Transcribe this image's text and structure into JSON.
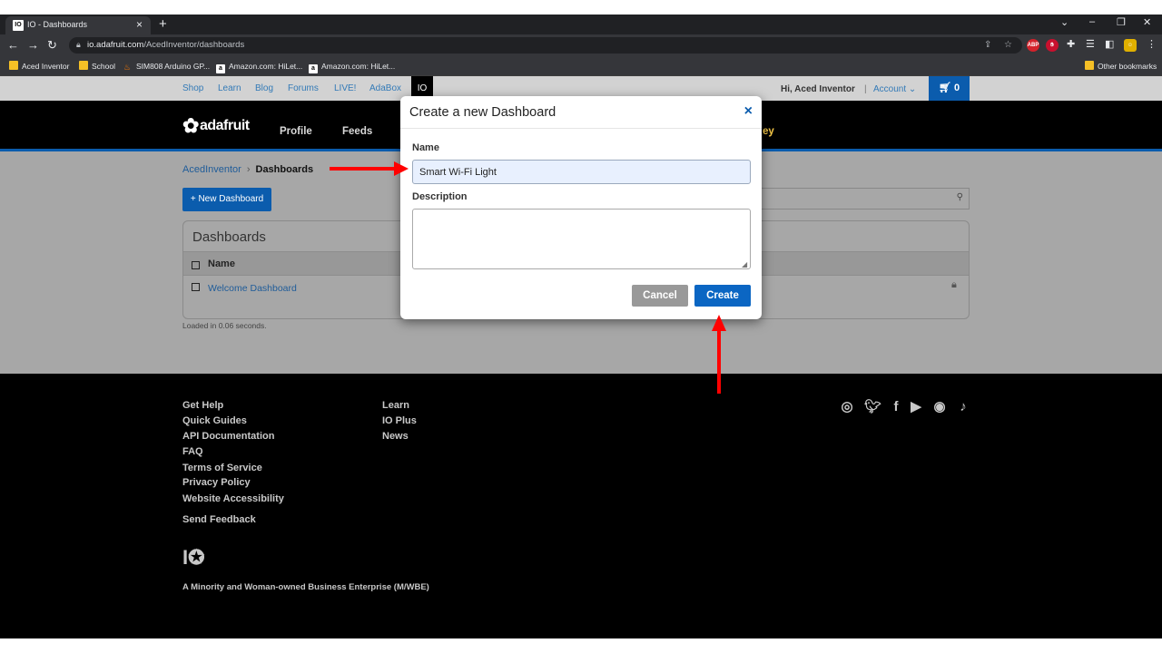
{
  "browser": {
    "tab_title": "IO - Dashboards",
    "tab_favicon": "IO",
    "tab_close_icon": "×",
    "new_tab_icon": "+",
    "url_host": "io.adafruit.com",
    "url_path": "/AcedInventor/dashboards",
    "extension_abp": "ABP",
    "bookmarks": [
      {
        "label": "Aced Inventor",
        "icon": "folder-icon"
      },
      {
        "label": "School",
        "icon": "folder-icon"
      },
      {
        "label": "SIM808 Arduino GP...",
        "icon": "sim-icon"
      },
      {
        "label": "Amazon.com: HiLet...",
        "icon": "amazon-icon"
      },
      {
        "label": "Amazon.com: HiLet...",
        "icon": "amazon-icon"
      }
    ],
    "other_bookmarks": "Other bookmarks"
  },
  "site": {
    "top_links": [
      "Shop",
      "Learn",
      "Blog",
      "Forums",
      "LIVE!",
      "AdaBox"
    ],
    "io_tab": "IO",
    "greeting": "Hi, Aced Inventor",
    "separator": "|",
    "account": "Account",
    "cart_count": "0",
    "logo_text": "adafruit",
    "nav": [
      "Profile",
      "Feeds"
    ],
    "nav_partial": "ey"
  },
  "content": {
    "breadcrumb_user": "AcedInventor",
    "breadcrumb_current": "Dashboards",
    "new_dashboard": "+ New Dashboard",
    "panel_title": "Dashboards",
    "column_name": "Name",
    "rows": [
      {
        "name": "Welcome Dashboard"
      }
    ],
    "loaded": "Loaded in 0.06 seconds."
  },
  "footer": {
    "col1": [
      "Get Help",
      "Quick Guides",
      "API Documentation",
      "FAQ",
      "Terms of Service",
      "Privacy Policy",
      "Website Accessibility"
    ],
    "send_feedback": "Send Feedback",
    "col2": [
      "Learn",
      "IO Plus",
      "News"
    ],
    "social": [
      "instagram-icon",
      "twitter-icon",
      "facebook-icon",
      "youtube-icon",
      "github-icon",
      "tiktok-icon"
    ],
    "mwbe": "A Minority and Woman-owned Business Enterprise (M/WBE)"
  },
  "modal": {
    "title": "Create a new Dashboard",
    "close_icon": "×",
    "name_label": "Name",
    "name_value": "Smart Wi-Fi Light",
    "description_label": "Description",
    "description_value": "",
    "cancel": "Cancel",
    "create": "Create"
  },
  "colors": {
    "accent": "#0b5cad",
    "annotation": "#ff0000"
  }
}
